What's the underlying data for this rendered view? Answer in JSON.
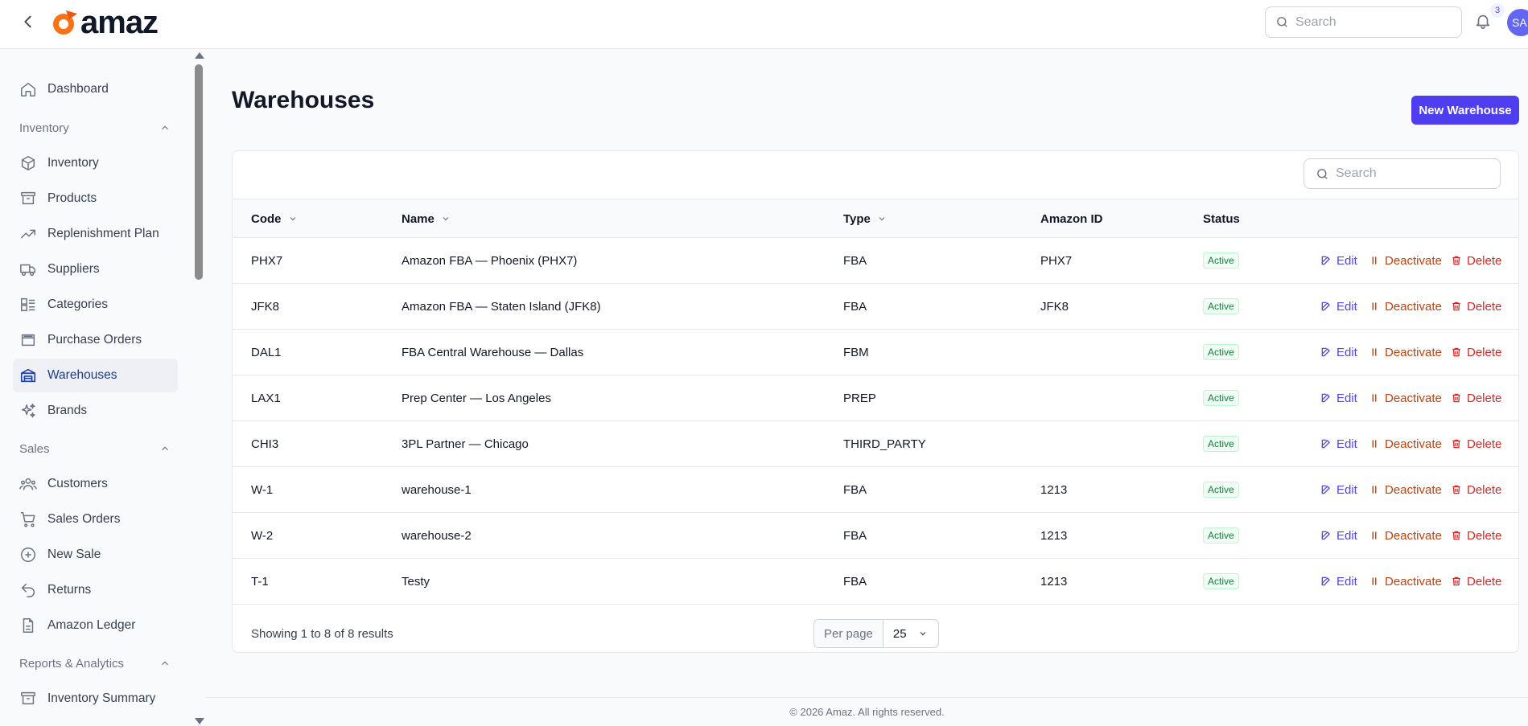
{
  "app": {
    "logo_text": "amaz"
  },
  "topbar": {
    "search_placeholder": "Search",
    "notification_count": "3",
    "avatar_initials": "SA"
  },
  "sidebar": {
    "dashboard": "Dashboard",
    "groups": {
      "inventory": "Inventory",
      "sales": "Sales",
      "reports": "Reports & Analytics"
    },
    "items": {
      "inventory": "Inventory",
      "products": "Products",
      "replenishment": "Replenishment Plan",
      "suppliers": "Suppliers",
      "categories": "Categories",
      "purchase_orders": "Purchase Orders",
      "warehouses": "Warehouses",
      "brands": "Brands",
      "customers": "Customers",
      "sales_orders": "Sales Orders",
      "new_sale": "New Sale",
      "returns": "Returns",
      "amazon_ledger": "Amazon Ledger",
      "inventory_summary": "Inventory Summary"
    }
  },
  "main": {
    "title": "Warehouses",
    "new_button": "New Warehouse",
    "table_search_placeholder": "Search",
    "columns": {
      "code": "Code",
      "name": "Name",
      "type": "Type",
      "amazon_id": "Amazon ID",
      "status": "Status"
    },
    "actions": {
      "edit": "Edit",
      "deactivate": "Deactivate",
      "delete": "Delete"
    },
    "rows": [
      {
        "code": "PHX7",
        "name": "Amazon FBA — Phoenix (PHX7)",
        "type": "FBA",
        "amazon_id": "PHX7",
        "status": "Active"
      },
      {
        "code": "JFK8",
        "name": "Amazon FBA — Staten Island (JFK8)",
        "type": "FBA",
        "amazon_id": "JFK8",
        "status": "Active"
      },
      {
        "code": "DAL1",
        "name": "FBA Central Warehouse — Dallas",
        "type": "FBM",
        "amazon_id": "",
        "status": "Active"
      },
      {
        "code": "LAX1",
        "name": "Prep Center — Los Angeles",
        "type": "PREP",
        "amazon_id": "",
        "status": "Active"
      },
      {
        "code": "CHI3",
        "name": "3PL Partner — Chicago",
        "type": "THIRD_PARTY",
        "amazon_id": "",
        "status": "Active"
      },
      {
        "code": "W-1",
        "name": "warehouse-1",
        "type": "FBA",
        "amazon_id": "1213",
        "status": "Active"
      },
      {
        "code": "W-2",
        "name": "warehouse-2",
        "type": "FBA",
        "amazon_id": "1213",
        "status": "Active"
      },
      {
        "code": "T-1",
        "name": "Testy",
        "type": "FBA",
        "amazon_id": "1213",
        "status": "Active"
      }
    ],
    "pagination": {
      "showing": "Showing 1 to 8 of 8 results",
      "per_page_label": "Per page",
      "per_page_value": "25"
    }
  },
  "footer": {
    "copyright": "© 2026 Amaz. All rights reserved."
  },
  "colors": {
    "primary": "#4f3df0",
    "active_nav": "#1e3a8a",
    "deactivate": "#c2410c",
    "delete": "#dc2626",
    "edit": "#4f46e5"
  }
}
